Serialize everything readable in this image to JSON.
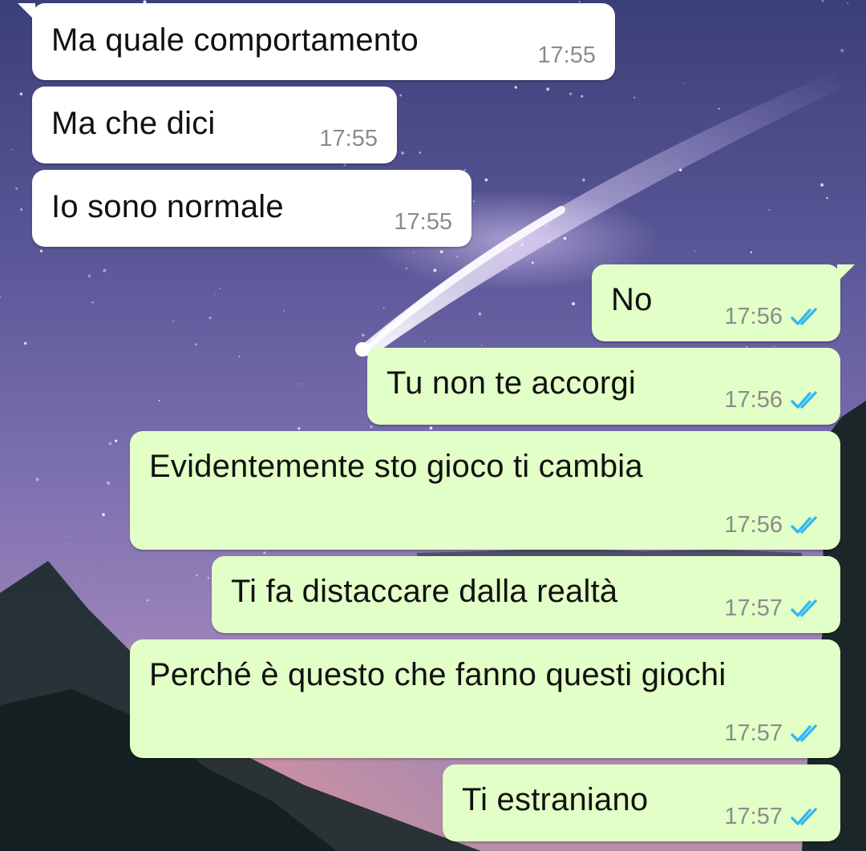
{
  "theme": {
    "incoming_bubble_color": "#ffffff",
    "outgoing_bubble_color": "#e2ffc7",
    "read_tick_color": "#34b7f1",
    "time_color": "#8b8b8b",
    "wallpaper": "night sky with comet and mountains"
  },
  "messages": [
    {
      "direction": "incoming",
      "text": "Ma quale comportamento",
      "time": "17:55"
    },
    {
      "direction": "incoming",
      "text": "Ma che dici",
      "time": "17:55"
    },
    {
      "direction": "incoming",
      "text": "Io sono normale",
      "time": "17:55"
    },
    {
      "direction": "outgoing",
      "text": "No",
      "time": "17:56",
      "status": "read",
      "status_icon": "double-check-icon"
    },
    {
      "direction": "outgoing",
      "text": "Tu non te accorgi",
      "time": "17:56",
      "status": "read",
      "status_icon": "double-check-icon"
    },
    {
      "direction": "outgoing",
      "text": "Evidentemente sto gioco ti cambia",
      "time": "17:56",
      "status": "read",
      "status_icon": "double-check-icon"
    },
    {
      "direction": "outgoing",
      "text": "Ti fa distaccare dalla realtà",
      "time": "17:57",
      "status": "read",
      "status_icon": "double-check-icon"
    },
    {
      "direction": "outgoing",
      "text": "Perché è questo che fanno questi giochi",
      "time": "17:57",
      "status": "read",
      "status_icon": "double-check-icon"
    },
    {
      "direction": "outgoing",
      "text": "Ti estraniano",
      "time": "17:57",
      "status": "read",
      "status_icon": "double-check-icon"
    }
  ]
}
